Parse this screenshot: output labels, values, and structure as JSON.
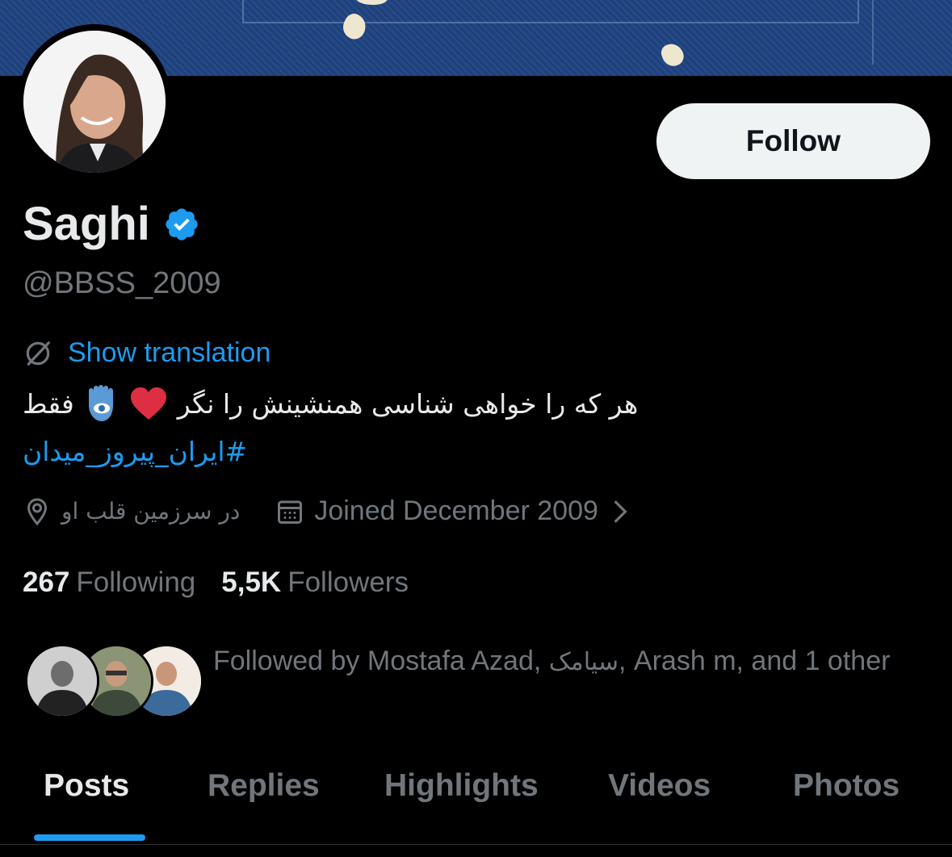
{
  "profile": {
    "display_name": "Saghi",
    "handle": "@BBSS_2009",
    "follow_label": "Follow",
    "show_translation": "Show translation",
    "bio_text": "هر که را خواهی شناسی همنشینش را نگر",
    "bio_suffix": "فقط",
    "hashtag": "#ایران_پیروز_میدان",
    "location": "در سرزمین قلب او",
    "joined": "Joined December 2009",
    "following_count": "267",
    "following_label": "Following",
    "followers_count": "5,5K",
    "followers_label": "Followers",
    "followed_by": {
      "prefix": "Followed by Mostafa Azad, ",
      "persian_name": "سیامک",
      "suffix": ", Arash m, and 1 other"
    }
  },
  "tabs": [
    {
      "label": "Posts",
      "active": true
    },
    {
      "label": "Replies",
      "active": false
    },
    {
      "label": "Highlights",
      "active": false
    },
    {
      "label": "Videos",
      "active": false
    },
    {
      "label": "Photos",
      "active": false
    }
  ],
  "colors": {
    "background": "#000000",
    "accent": "#1d9bf0",
    "text_primary": "#e7e9ea",
    "text_secondary": "#71767b",
    "follow_button_bg": "#eff3f4"
  },
  "icons": [
    "verified-badge-icon",
    "translate-icon",
    "heart-emoji-icon",
    "hamsa-emoji-icon",
    "location-pin-icon",
    "calendar-icon",
    "chevron-right-icon"
  ]
}
